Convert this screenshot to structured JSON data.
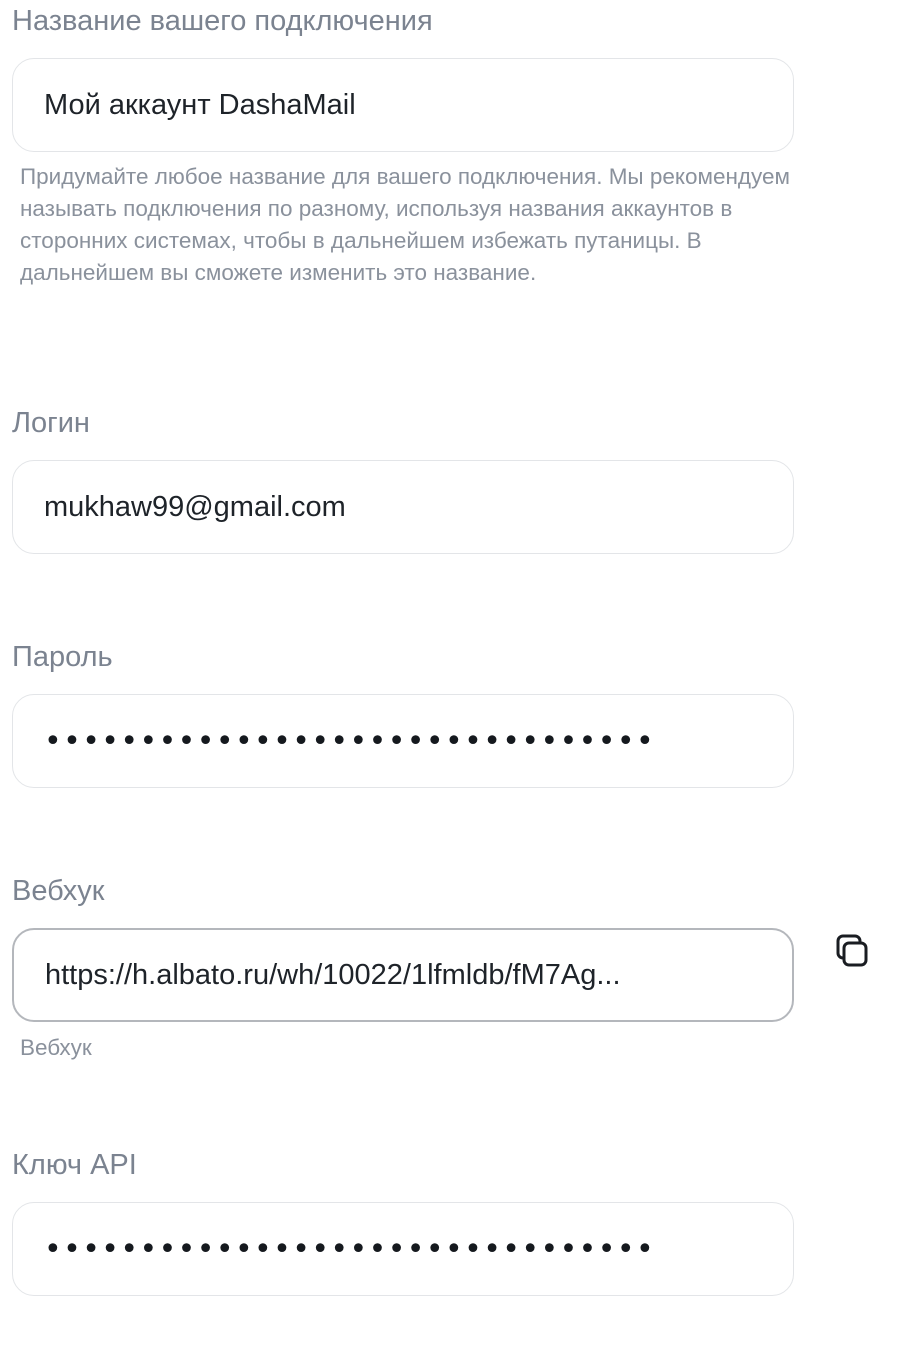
{
  "connection_name": {
    "label": "Название вашего подключения",
    "value": "Мой аккаунт DashaMail",
    "hint": "Придумайте любое название для вашего подключения. Мы рекомендуем называть подключения по разному, используя названия аккаунтов в сторонних системах, чтобы в дальнейшем избежать путаницы. В дальнейшем вы сможете изменить это название."
  },
  "login": {
    "label": "Логин",
    "value": "mukhaw99@gmail.com"
  },
  "password": {
    "label": "Пароль",
    "masked_value": "••••••••••••••••••••••••••••••••"
  },
  "webhook": {
    "label": "Вебхук",
    "value": "https://h.albato.ru/wh/10022/1lfmldb/fM7Ag...",
    "hint": "Вебхук",
    "copy_icon": "copy-icon"
  },
  "api_key": {
    "label": "Ключ API",
    "masked_value": "••••••••••••••••••••••••••••••••"
  }
}
